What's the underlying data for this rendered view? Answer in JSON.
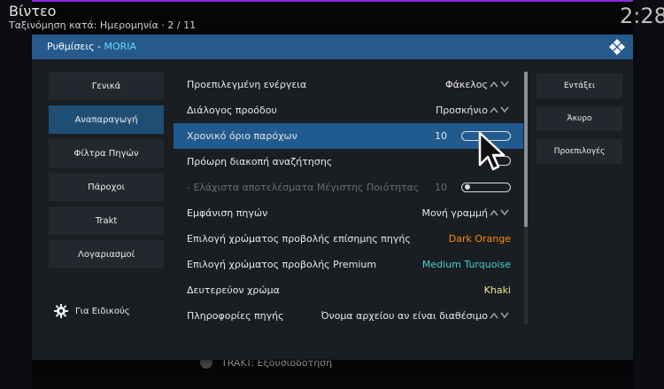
{
  "header": {
    "title": "Βίντεο",
    "subtitle": "Ταξινόμηση κατά: Ημερομηνία  ·  2 / 11",
    "clock": "2:28"
  },
  "background_row": {
    "label": "TRAKT: Εξουσιοδότηση"
  },
  "dialog": {
    "title_prefix": "Ρυθμίσεις - ",
    "title_addon": "MORIA",
    "categories": [
      "Γενικά",
      "Αναπαραγωγή",
      "Φίλτρα Πηγών",
      "Πάροχοι",
      "Trakt",
      "Λογαριασμοί"
    ],
    "active_category": 1,
    "experts_label": "Για Ειδικούς",
    "settings": [
      {
        "label": "Προεπιλεγμένη ενέργεια",
        "value": "Φάκελος",
        "control": "spinner"
      },
      {
        "label": "Διάλογος προόδου",
        "value": "Προσκήνιο",
        "control": "spinner"
      },
      {
        "label": "Χρονικό όριο παρόχων",
        "value": "10",
        "control": "slider",
        "focused": true
      },
      {
        "label": "Πρόωρη διακοπή αναζήτησης",
        "value": "",
        "control": "toggle"
      },
      {
        "label": "- Ελάχιστα αποτελέσματα Μέγιστης Ποιότητας",
        "value": "10",
        "control": "slider",
        "disabled": true
      },
      {
        "label": "Εμφάνιση πηγών",
        "value": "Μονή γραμμή",
        "control": "spinner"
      },
      {
        "label": "Επιλογή χρώματος προβολής επίσημης πηγής",
        "value": "Dark Orange",
        "control": "color",
        "color": "#ff8c00"
      },
      {
        "label": "Επιλογή χρώματος προβολής Premium",
        "value": "Medium Turquoise",
        "control": "color",
        "color": "#48d1cc"
      },
      {
        "label": "Δευτερεύον χρώμα",
        "value": "Khaki",
        "control": "color",
        "color": "#f0e68c"
      },
      {
        "label": "Πληροφορίες πηγής",
        "value": "Όνομα αρχείου αν είναι διαθέσιμο",
        "control": "spinner"
      }
    ],
    "actions": [
      "Εντάξει",
      "Άκυρο",
      "Προεπιλογές"
    ]
  },
  "colors": {
    "accent": "#255a8b",
    "focus": "#215a8e",
    "title_addon": "#61d7ff"
  }
}
